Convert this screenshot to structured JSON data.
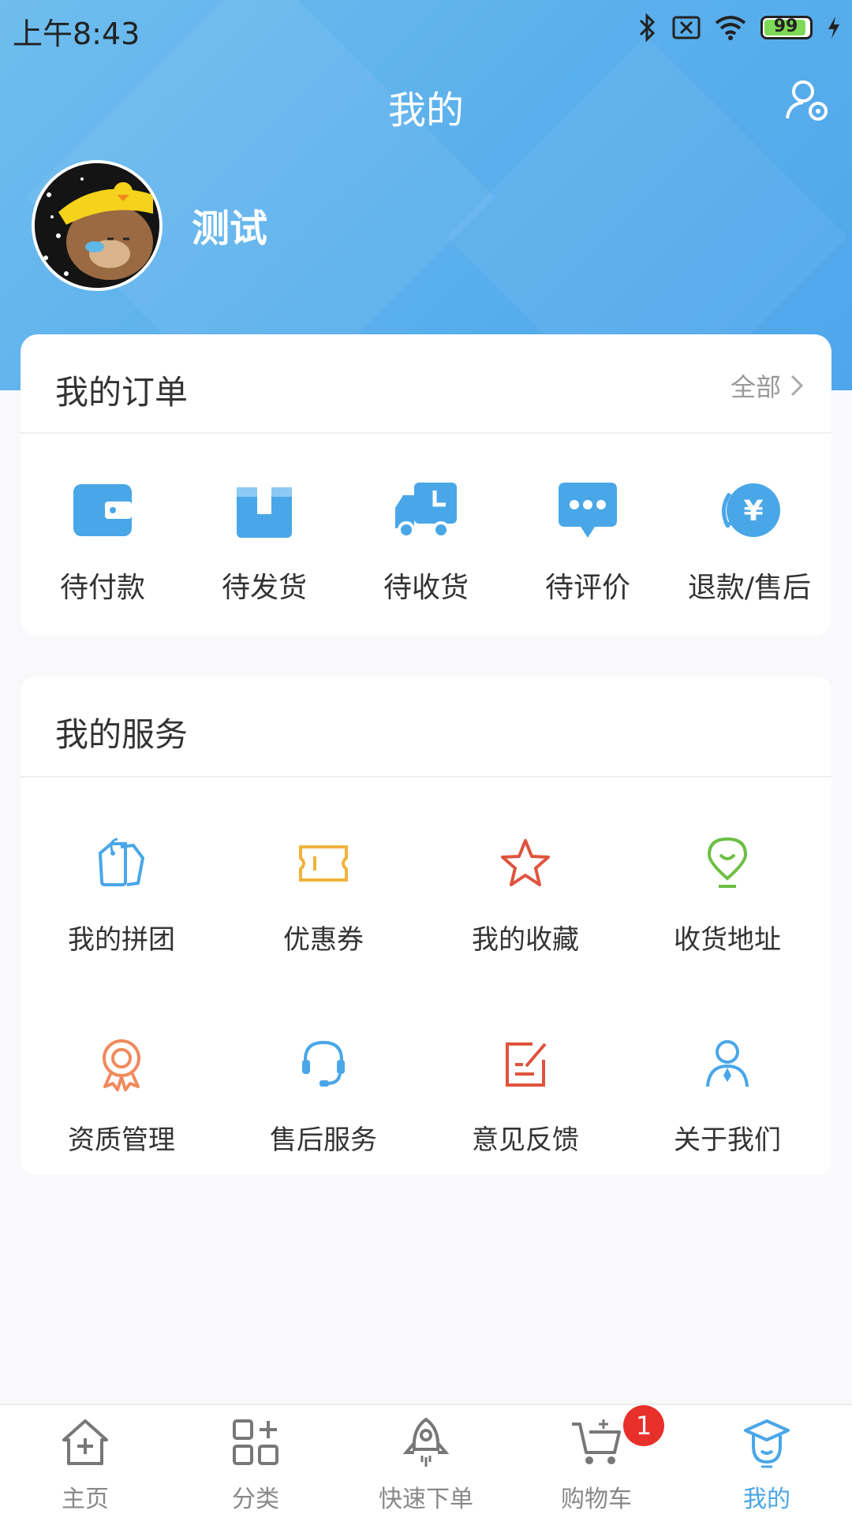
{
  "status_bar": {
    "time": "上午8:43",
    "battery": "99"
  },
  "header": {
    "title": "我的",
    "username": "测试"
  },
  "orders": {
    "title": "我的订单",
    "view_all": "全部",
    "items": [
      {
        "label": "待付款",
        "icon": "wallet-icon"
      },
      {
        "label": "待发货",
        "icon": "box-icon"
      },
      {
        "label": "待收货",
        "icon": "truck-icon"
      },
      {
        "label": "待评价",
        "icon": "chat-icon"
      },
      {
        "label": "退款/售后",
        "icon": "refund-icon"
      }
    ]
  },
  "services": {
    "title": "我的服务",
    "items": [
      {
        "label": "我的拼团",
        "icon": "group-tag-icon"
      },
      {
        "label": "优惠券",
        "icon": "coupon-icon"
      },
      {
        "label": "我的收藏",
        "icon": "star-icon"
      },
      {
        "label": "收货地址",
        "icon": "location-icon"
      },
      {
        "label": "资质管理",
        "icon": "award-icon"
      },
      {
        "label": "售后服务",
        "icon": "headset-icon"
      },
      {
        "label": "意见反馈",
        "icon": "feedback-icon"
      },
      {
        "label": "关于我们",
        "icon": "person-icon"
      }
    ]
  },
  "tabbar": {
    "items": [
      {
        "label": "主页",
        "icon": "home-icon"
      },
      {
        "label": "分类",
        "icon": "category-icon"
      },
      {
        "label": "快速下单",
        "icon": "rocket-icon"
      },
      {
        "label": "购物车",
        "icon": "cart-icon"
      },
      {
        "label": "我的",
        "icon": "profile-icon"
      }
    ],
    "active": "我的",
    "cart_badge": "1"
  },
  "colors": {
    "accent": "#4aa6e8",
    "header": "#5bb0ec",
    "badge": "#e8302b"
  }
}
